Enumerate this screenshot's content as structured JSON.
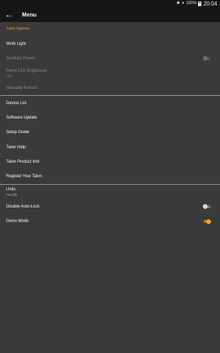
{
  "status_bar": {
    "battery_pct": "100%",
    "time": "20:04",
    "icons": [
      "bluetooth-icon",
      "wifi-icon",
      "battery-icon"
    ]
  },
  "app_bar": {
    "back_icon": "arrow-back-icon",
    "title": "Menu"
  },
  "talon_options": {
    "header": "Talon Options",
    "work_light": "Work Light",
    "auxiliary_power": "Auxiliary Power",
    "auxiliary_power_on": false,
    "panel_led": "Panel LED Brightness",
    "panel_led_value": "High",
    "manually_retract": "Manually Retract"
  },
  "menu_items": {
    "device_list": "Device List",
    "software_update": "Software Update",
    "setup_guide": "Setup Guide",
    "talon_help": "Talon Help",
    "talon_product_info": "Talon Product Info",
    "register": "Register Your Talon"
  },
  "settings": {
    "units": "Units",
    "units_value": "Feet (ft)",
    "disable_auto_lock": "Disable Auto-Lock",
    "disable_auto_lock_on": false,
    "demo_mode": "Demo Mode",
    "demo_mode_on": true
  },
  "colors": {
    "accent": "#f5a623",
    "background": "#3a3a3a",
    "bar": "#161616"
  }
}
